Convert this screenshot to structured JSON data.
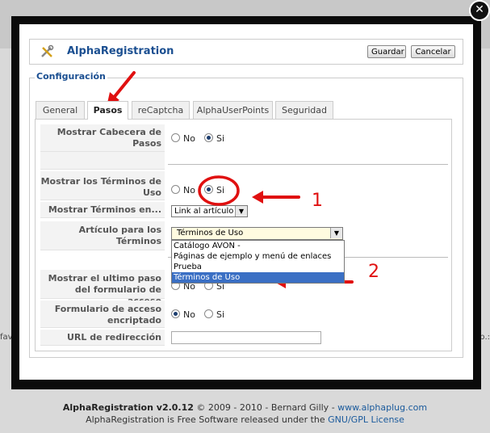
{
  "window": {
    "close_glyph": "✕"
  },
  "toolbar": {
    "app_title": "AlphaRegistration",
    "save_label": "Guardar",
    "cancel_label": "Cancelar"
  },
  "fieldset": {
    "legend": "Configuración"
  },
  "tabs": [
    {
      "label": "General",
      "active": false
    },
    {
      "label": "Pasos",
      "active": true
    },
    {
      "label": "reCaptcha",
      "active": false
    },
    {
      "label": "AlphaUserPoints",
      "active": false
    },
    {
      "label": "Seguridad",
      "active": false
    }
  ],
  "form": {
    "cabecera": {
      "label_l1": "Mostrar Cabecera de",
      "label_l2": "Pasos",
      "no": "No",
      "si": "Si",
      "selected": "Si"
    },
    "terminos": {
      "label_l1": "Mostrar los Términos de",
      "label_l2": "Uso",
      "no": "No",
      "si": "Si",
      "selected": "Si"
    },
    "terminos_en": {
      "label": "Mostrar Términos en...",
      "value": "Link al artículo"
    },
    "articulo": {
      "label_l1": "Artículo para los",
      "label_l2": "Términos",
      "value": "Términos de Uso",
      "options": [
        "Catálogo AVON -",
        "Páginas de ejemplo y menú de enlaces",
        "Prueba",
        "Términos de Uso"
      ],
      "highlighted": "Términos de Uso"
    },
    "ultimo_paso": {
      "label_l1": "Mostrar el ultimo paso",
      "label_l2": "del formulario de acceso",
      "no": "No",
      "si": "Si"
    },
    "encriptado": {
      "label_l1": "Formulario de acceso",
      "label_l2": "encriptado",
      "no": "No",
      "si": "Si",
      "selected": "No"
    },
    "redireccion": {
      "label": "URL de redirección",
      "value": ""
    }
  },
  "annotations": {
    "one": "1",
    "two": "2",
    "color": "#e01010"
  },
  "background": {
    "left_fragment": "fav",
    "right_fragment": "p.:"
  },
  "footer": {
    "line1_prefix": "AlphaRegistration v2.0.12",
    "line1_mid": " © 2009 - 2010 - Bernard Gilly - ",
    "line1_link": "www.alphaplug.com",
    "line2_prefix": "AlphaRegistration is Free Software released under the ",
    "line2_link": "GNU/GPL License"
  }
}
